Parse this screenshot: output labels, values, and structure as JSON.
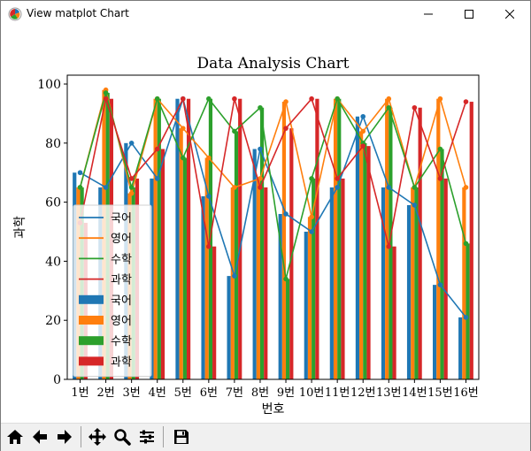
{
  "window": {
    "title": "View matplot Chart"
  },
  "toolbar": {
    "buttons": [
      {
        "name": "home-button",
        "icon": "home-icon"
      },
      {
        "name": "back-button",
        "icon": "arrow-left-icon"
      },
      {
        "name": "forward-button",
        "icon": "arrow-right-icon"
      },
      {
        "name": "pan-button",
        "icon": "move-icon"
      },
      {
        "name": "zoom-button",
        "icon": "magnifier-icon"
      },
      {
        "name": "configure-subplots-button",
        "icon": "sliders-icon"
      },
      {
        "name": "save-button",
        "icon": "floppy-icon"
      }
    ]
  },
  "chart_data": {
    "type": "bar",
    "title": "Data Analysis Chart",
    "xlabel": "번호",
    "ylabel": "과학",
    "ylim": [
      0,
      103
    ],
    "yticks": [
      0,
      20,
      40,
      60,
      80,
      100
    ],
    "categories": [
      "1번",
      "2번",
      "3번",
      "4번",
      "5번",
      "6번",
      "7번",
      "8번",
      "9번",
      "10번",
      "11번",
      "12번",
      "13번",
      "14번",
      "15번",
      "16번"
    ],
    "series": [
      {
        "name": "국어",
        "color": "#1f77b4",
        "values": [
          70,
          65,
          80,
          68,
          95,
          62,
          35,
          78,
          56,
          50,
          65,
          89,
          65,
          59,
          32,
          21
        ]
      },
      {
        "name": "영어",
        "color": "#ff7f0e",
        "values": [
          65,
          98,
          63,
          95,
          85,
          75,
          65,
          68,
          94,
          55,
          95,
          84,
          95,
          65,
          95,
          65
        ]
      },
      {
        "name": "수학",
        "color": "#2ca02c",
        "values": [
          65,
          97,
          65,
          95,
          75,
          95,
          84,
          92,
          34,
          68,
          95,
          80,
          92,
          65,
          78,
          46
        ]
      },
      {
        "name": "과학",
        "color": "#d62728",
        "values": [
          53,
          95,
          68,
          78,
          95,
          45,
          95,
          65,
          85,
          95,
          68,
          79,
          45,
          92,
          68,
          94
        ]
      }
    ],
    "legend": {
      "placement": "lower-left",
      "entries": [
        {
          "label": "국어",
          "kind": "line",
          "color": "#1f77b4"
        },
        {
          "label": "영어",
          "kind": "line",
          "color": "#ff7f0e"
        },
        {
          "label": "수학",
          "kind": "line",
          "color": "#2ca02c"
        },
        {
          "label": "과학",
          "kind": "line",
          "color": "#d62728"
        },
        {
          "label": "국어",
          "kind": "bar",
          "color": "#1f77b4"
        },
        {
          "label": "영어",
          "kind": "bar",
          "color": "#ff7f0e"
        },
        {
          "label": "수학",
          "kind": "bar",
          "color": "#2ca02c"
        },
        {
          "label": "과학",
          "kind": "bar",
          "color": "#d62728"
        }
      ]
    },
    "grid": false
  }
}
